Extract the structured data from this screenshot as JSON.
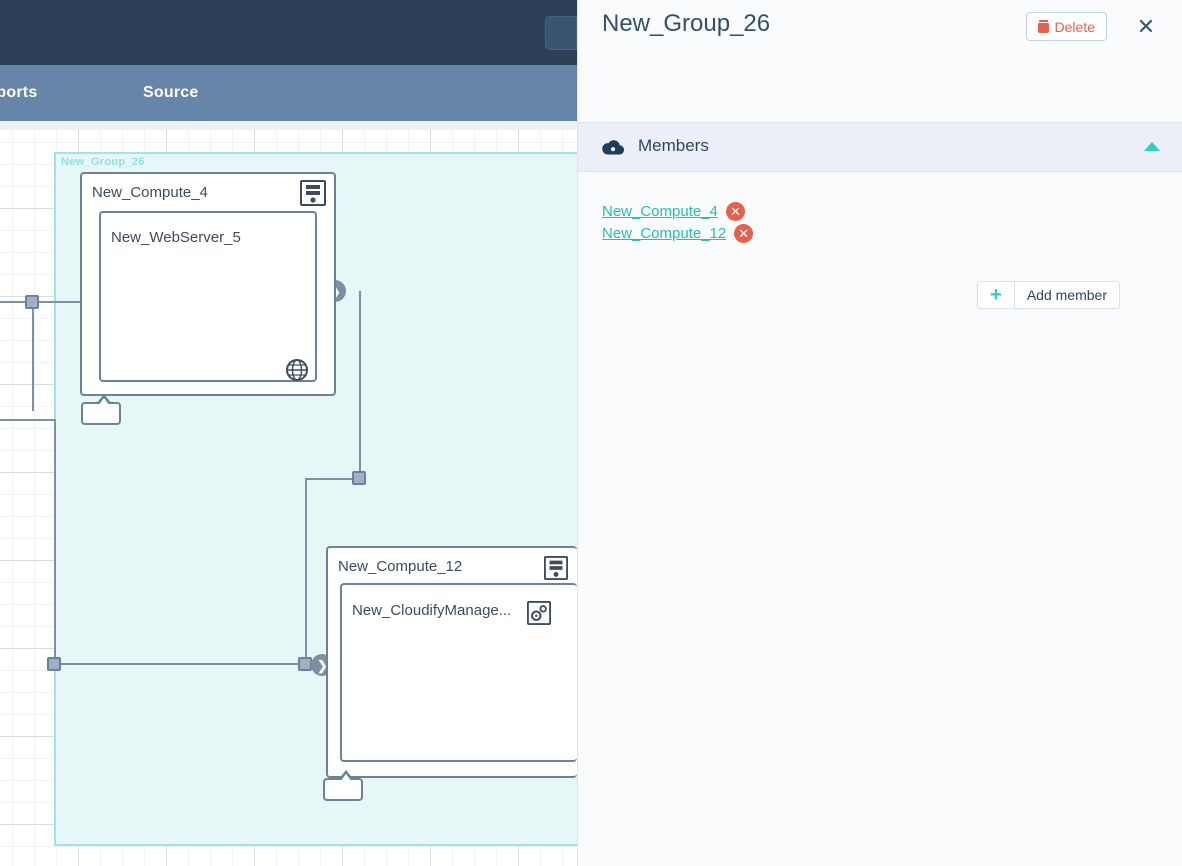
{
  "app": {
    "nav": {
      "imports_label": "mports",
      "source_label": "Source"
    }
  },
  "canvas": {
    "group_label": "New_Group_26",
    "nodes": [
      {
        "title": "New_Compute_4",
        "icon": "server-icon"
      },
      {
        "title": "New_WebServer_5",
        "icon": "globe-icon"
      },
      {
        "title": "New_Compute_12",
        "icon": "server-icon"
      },
      {
        "title": "New_CloudifyManage...",
        "icon": "gears-icon"
      }
    ]
  },
  "panel": {
    "title": "New_Group_26",
    "delete_label": "Delete",
    "close_label": "✕",
    "section": {
      "title": "Members",
      "icon": "cloud-icon",
      "collapse_state": "expanded"
    },
    "members": [
      {
        "name": "New_Compute_4",
        "remove_label": "✕"
      },
      {
        "name": "New_Compute_12",
        "remove_label": "✕"
      }
    ],
    "add_member": {
      "plus_label": "+",
      "label": "Add member"
    }
  },
  "colors": {
    "topbar": "#2c4158",
    "navbar": "#6685a8",
    "accent_teal": "#2bcfc4",
    "member_link": "#21bfb5",
    "danger": "#e8604c",
    "title": "#32506e",
    "group_fill": "#e7f7f7",
    "group_border": "#9fe3e6",
    "node_border": "#6b8299"
  }
}
